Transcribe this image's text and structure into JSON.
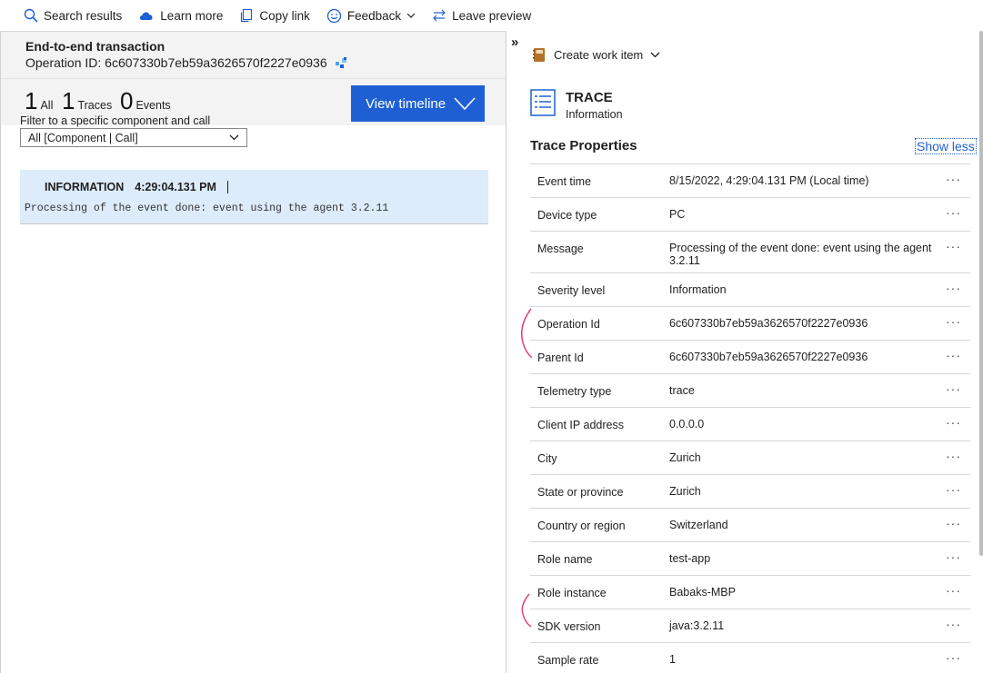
{
  "toolbar": {
    "items": [
      {
        "label": "Search results",
        "icon": "search-icon"
      },
      {
        "label": "Learn more",
        "icon": "cloud-icon"
      },
      {
        "label": "Copy link",
        "icon": "copy-icon"
      },
      {
        "label": "Feedback",
        "icon": "smiley-icon"
      },
      {
        "label": "Leave preview",
        "icon": "swap-icon"
      }
    ]
  },
  "left": {
    "title": "End-to-end transaction",
    "operation": "Operation ID: 6c607330b7eb59a3626570f2227e0936",
    "counts": [
      {
        "num": "1",
        "label": "All"
      },
      {
        "num": "1",
        "label": "Traces"
      },
      {
        "num": "0",
        "label": "Events"
      }
    ],
    "view_timeline": "View timeline",
    "filter_label": "Filter to a specific component and call",
    "filter_value": "All [Component | Call]",
    "trace": {
      "level": "INFORMATION",
      "time": "4:29:04.131 PM",
      "message": "Processing of the event done: event using the agent 3.2.11"
    }
  },
  "right": {
    "collapse": "»",
    "work_item": "Create work item",
    "trace_title": "TRACE",
    "trace_subtitle": "Information",
    "props_title": "Trace Properties",
    "show_less": "Show less",
    "more": "···",
    "properties": [
      {
        "key": "Event time",
        "value": "8/15/2022, 4:29:04.131 PM (Local time)"
      },
      {
        "key": "Device type",
        "value": "PC"
      },
      {
        "key": "Message",
        "value": "Processing of the event done: event using the agent 3.2.11"
      },
      {
        "key": "Severity level",
        "value": "Information"
      },
      {
        "key": "Operation Id",
        "value": "6c607330b7eb59a3626570f2227e0936"
      },
      {
        "key": "Parent Id",
        "value": "6c607330b7eb59a3626570f2227e0936"
      },
      {
        "key": "Telemetry type",
        "value": "trace"
      },
      {
        "key": "Client IP address",
        "value": "0.0.0.0"
      },
      {
        "key": "City",
        "value": "Zurich"
      },
      {
        "key": "State or province",
        "value": "Zurich"
      },
      {
        "key": "Country or region",
        "value": "Switzerland"
      },
      {
        "key": "Role name",
        "value": "test-app"
      },
      {
        "key": "Role instance",
        "value": "Babaks-MBP"
      },
      {
        "key": "SDK version",
        "value": "java:3.2.11"
      },
      {
        "key": "Sample rate",
        "value": "1"
      }
    ]
  },
  "colors": {
    "accent": "#1e60d4",
    "highlight": "#dcecfb",
    "annotation": "#e0407a"
  }
}
